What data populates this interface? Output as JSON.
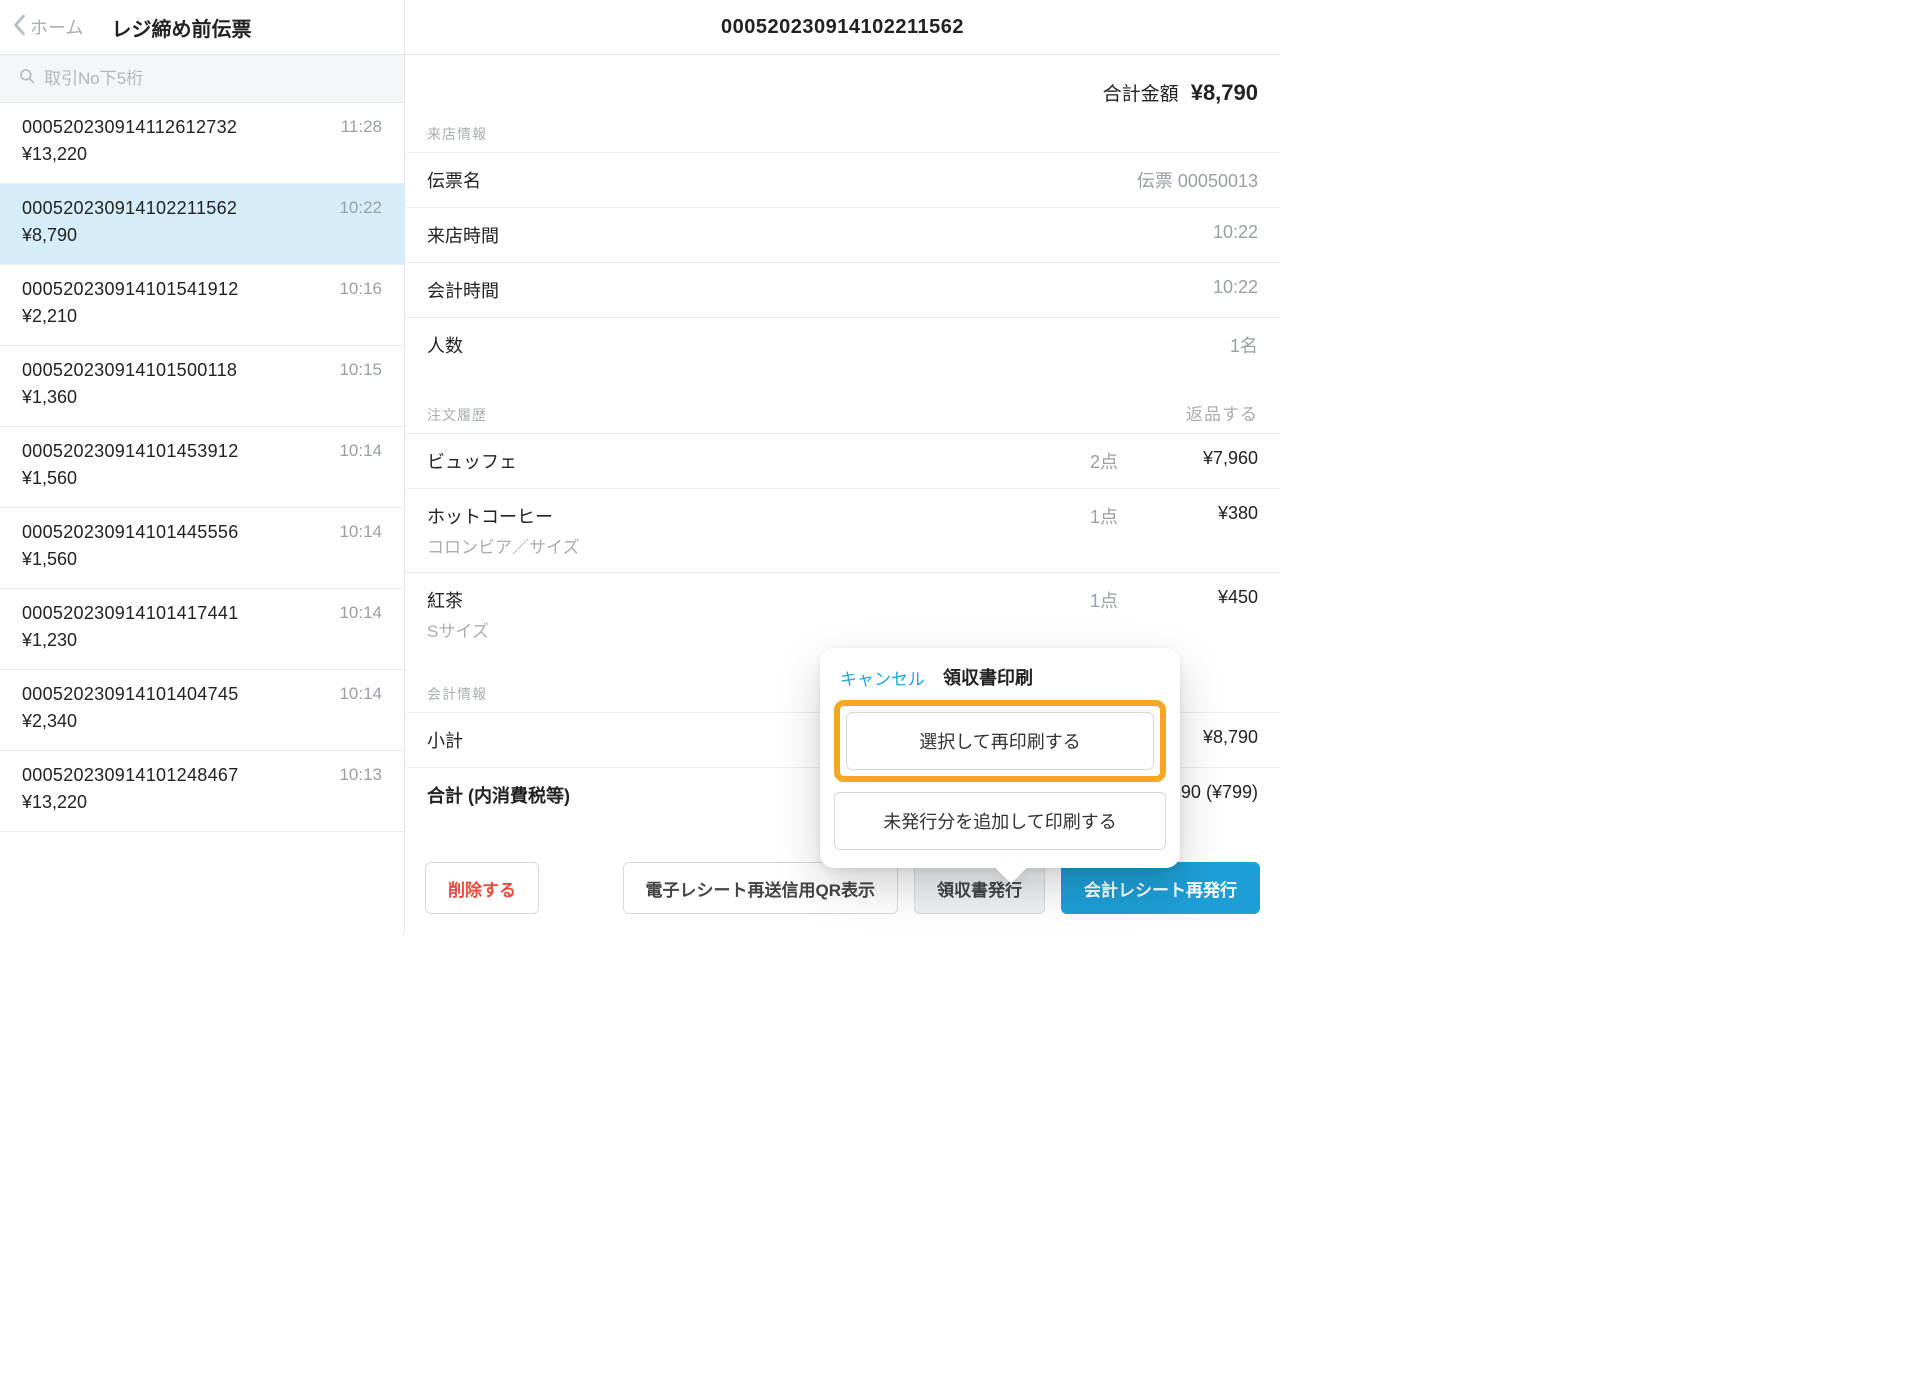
{
  "sidebar": {
    "back_label": "ホーム",
    "title": "レジ締め前伝票",
    "search_placeholder": "取引No下5桁"
  },
  "slips": [
    {
      "no": "000520230914112612732",
      "time": "11:28",
      "amount": "¥13,220"
    },
    {
      "no": "000520230914102211562",
      "time": "10:22",
      "amount": "¥8,790",
      "selected": true
    },
    {
      "no": "000520230914101541912",
      "time": "10:16",
      "amount": "¥2,210"
    },
    {
      "no": "000520230914101500118",
      "time": "10:15",
      "amount": "¥1,360"
    },
    {
      "no": "000520230914101453912",
      "time": "10:14",
      "amount": "¥1,560"
    },
    {
      "no": "000520230914101445556",
      "time": "10:14",
      "amount": "¥1,560"
    },
    {
      "no": "000520230914101417441",
      "time": "10:14",
      "amount": "¥1,230"
    },
    {
      "no": "000520230914101404745",
      "time": "10:14",
      "amount": "¥2,340"
    },
    {
      "no": "000520230914101248467",
      "time": "10:13",
      "amount": "¥13,220"
    }
  ],
  "detail": {
    "header_title": "000520230914102211562",
    "total_label": "合計金額",
    "total_amount": "¥8,790",
    "visit_section_label": "来店情報",
    "visit": {
      "slip_name_label": "伝票名",
      "slip_name_value": "伝票 00050013",
      "visit_time_label": "来店時間",
      "visit_time_value": "10:22",
      "checkout_time_label": "会計時間",
      "checkout_time_value": "10:22",
      "guests_label": "人数",
      "guests_value": "1名"
    },
    "order_section_label": "注文履歴",
    "order_return_label": "返品する",
    "orders": [
      {
        "name": "ビュッフェ",
        "sub": "",
        "qty": "2点",
        "price": "¥7,960"
      },
      {
        "name": "ホットコーヒー",
        "sub": "コロンビア／サイズ",
        "qty": "1点",
        "price": "¥380"
      },
      {
        "name": "紅茶",
        "sub": "Sサイズ",
        "qty": "1点",
        "price": "¥450"
      }
    ],
    "pay_section_label": "会計情報",
    "pay": {
      "subtotal_label": "小計",
      "subtotal_value": "¥8,790",
      "total_label": "合計 (内消費税等)",
      "total_value_amount": "90",
      "total_value_tax": "(¥799)"
    }
  },
  "actions": {
    "delete": "削除する",
    "qr": "電子レシート再送信用QR表示",
    "receipt": "領収書発行",
    "reprint": "会計レシート再発行"
  },
  "popover": {
    "cancel": "キャンセル",
    "title": "領収書印刷",
    "option_select_reprint": "選択して再印刷する",
    "option_add_unissued": "未発行分を追加して印刷する"
  }
}
